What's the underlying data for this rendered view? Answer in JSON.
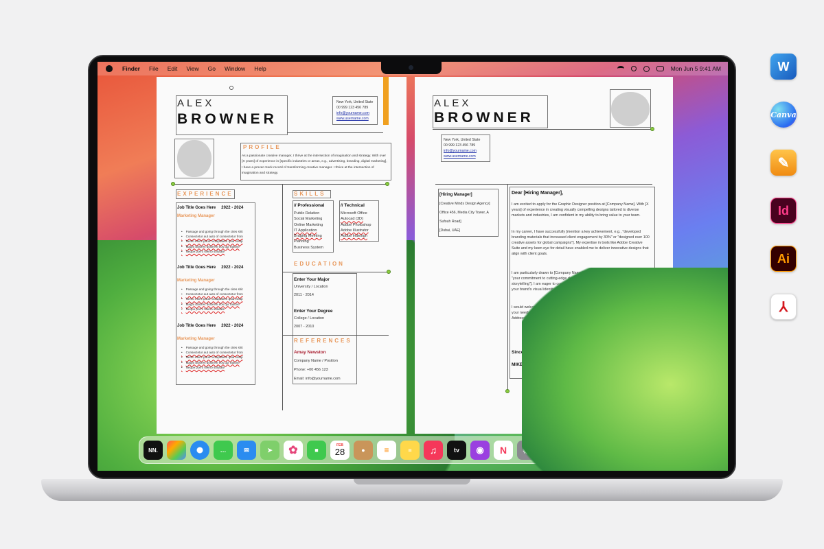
{
  "menubar": {
    "apple": "",
    "items": [
      "Finder",
      "File",
      "Edit",
      "View",
      "Go",
      "Window",
      "Help"
    ],
    "datetime": "Mon Jun 5  9:41 AM"
  },
  "resume": {
    "first_name": "ALEX",
    "last_name": "BROWNER",
    "contact": {
      "location": "New York, United State",
      "phone": "00 999 123 456 789",
      "email": "info@yourname.com",
      "web": "www.username.com"
    },
    "profile_title": "PROFILE",
    "profile_text": "As a passionate creative manager, I thrive at the intersection of imagination and strategy. With over [X years] of experience in [specific industries or areas, e.g., advertising, branding, digital marketing], I have a proven track record of transforming creative manager. I thrive at the intersection of imagination and strategy.",
    "experience_title": "EXPERIENCE",
    "jobs": [
      {
        "title": "Job Title Goes Here",
        "years": "2022 - 2024",
        "role": "Marketing Manager"
      },
      {
        "title": "Job Title Goes Here",
        "years": "2022 - 2024",
        "role": "Marketing Manager"
      },
      {
        "title": "Job Title Goes Here",
        "years": "2022 - 2024",
        "role": "Marketing Manager"
      }
    ],
    "bullets": [
      "Passage and going through the cites shit",
      "Consectetur aut auto of consectetur from",
      "Nemo enim ipsum voluptatem quia volup",
      "Magni dolores dolorem eos qui ratione",
      "Neque porro Nemo solutate"
    ],
    "skills_title": "SKILLS",
    "professional_title": "// Professional",
    "professional": [
      "Public Relation",
      "Social Marketing",
      "Online Marketing",
      "IT Application",
      "Braging Meeting",
      "Planning",
      "Business System"
    ],
    "technical_title": "// Technical",
    "technical": [
      "Microsoft Office",
      "Autocad (3D)",
      "Adobe Photoshop",
      "Adobe Illustrator",
      "Adobe Indesign"
    ],
    "education_title": "EDUCATION",
    "education": [
      {
        "degree": "Enter Your Major",
        "school": "University / Location",
        "years": "2011 - 2014"
      },
      {
        "degree": "Enter Your Degree",
        "school": "College / Location",
        "years": "2007 - 2010"
      }
    ],
    "references_title": "REFERENCES",
    "reference": {
      "name": "Amay Newston",
      "company": "Company Name / Position",
      "phone": "Phone: +00 456 123",
      "email": "Email: info@yourname.com"
    }
  },
  "cover_letter": {
    "first_name": "ALEX",
    "last_name": "BROWNER",
    "contact": {
      "location": "New York, United State",
      "phone": "00 999 123 456 789",
      "email": "info@yourname.com",
      "web": "www.username.com"
    },
    "recipient": [
      "[Hiring Manager]",
      "[Creative Minds Design Agency]",
      "Office 456, Media City Tower, A",
      "Sufouh Road]",
      "[Dubai, UAE]"
    ],
    "greeting": "Dear [Hiring Manager],",
    "paragraphs": [
      "I am excited to apply for the Graphic Designer position at [Company Name]. With [X years] of experience in creating visually compelling designs tailored to diverse markets and industries, I am confident in my ability to bring value to your team.",
      "In my career, I have successfully [mention a key achievement, e.g., \"developed branding materials that increased client engagement by 30%\" or \"designed over 100 creative assets for global campaigns\"]. My expertise in tools like Adobe Creative Suite and my keen eye for detail have enabled me to deliver innovative designs that align with client goals.",
      "I am particularly drawn to [Company Name] because of [specific company detail, e.g., \"your commitment to cutting-edge design trends\" or \"your focus on impactful visual storytelling\"]. I am eager to contribute my creativity and technical skills to enhance your brand's visual identity.",
      "I would welcome the opportunity to discuss how my skills and experience align with your needs. Please feel free to contact me at [Your Phone Number] or [Your Email Address]. Thank you for considering my application."
    ],
    "closing": "Sincerely,",
    "signature": "MIKE RICHRD"
  },
  "dock": {
    "calendar_month": "FEB",
    "calendar_day": "28",
    "tv_label": "tv",
    "notion_label": "NN."
  },
  "side_apps": {
    "word": "W",
    "canva": "Canva",
    "indesign": "Id",
    "illustrator": "Ai"
  }
}
